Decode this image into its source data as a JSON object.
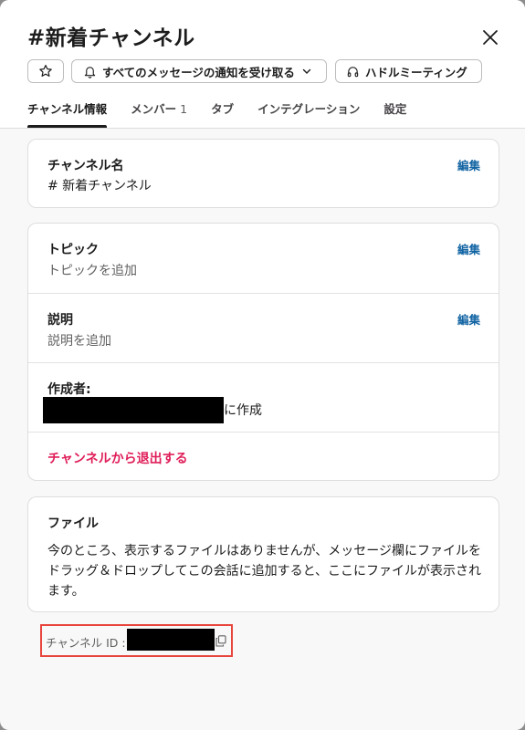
{
  "header": {
    "title": "#新着チャンネル",
    "notify_label": "すべてのメッセージの通知を受け取る",
    "huddle_label": "ハドルミーティング"
  },
  "tabs": [
    {
      "label": "チャンネル情報",
      "count": ""
    },
    {
      "label": "メンバー",
      "count": "1"
    },
    {
      "label": "タブ",
      "count": ""
    },
    {
      "label": "インテグレーション",
      "count": ""
    },
    {
      "label": "設定",
      "count": ""
    }
  ],
  "channel_name": {
    "label": "チャンネル名",
    "value": "# 新着チャンネル",
    "edit": "編集"
  },
  "topic": {
    "label": "トピック",
    "value": "トピックを追加",
    "edit": "編集"
  },
  "description": {
    "label": "説明",
    "value": "説明を追加",
    "edit": "編集"
  },
  "creator": {
    "label": "作成者:",
    "suffix": "に作成"
  },
  "leave": {
    "label": "チャンネルから退出する"
  },
  "files": {
    "label": "ファイル",
    "text": "今のところ、表示するファイルはありませんが、メッセージ欄にファイルをドラッグ＆ドロップしてこの会話に追加すると、ここにファイルが表示されます。"
  },
  "channel_id": {
    "label": "チャンネル ID :"
  },
  "colors": {
    "accent": "#1264a3",
    "danger": "#e01e5a",
    "highlight": "#e8453c"
  }
}
